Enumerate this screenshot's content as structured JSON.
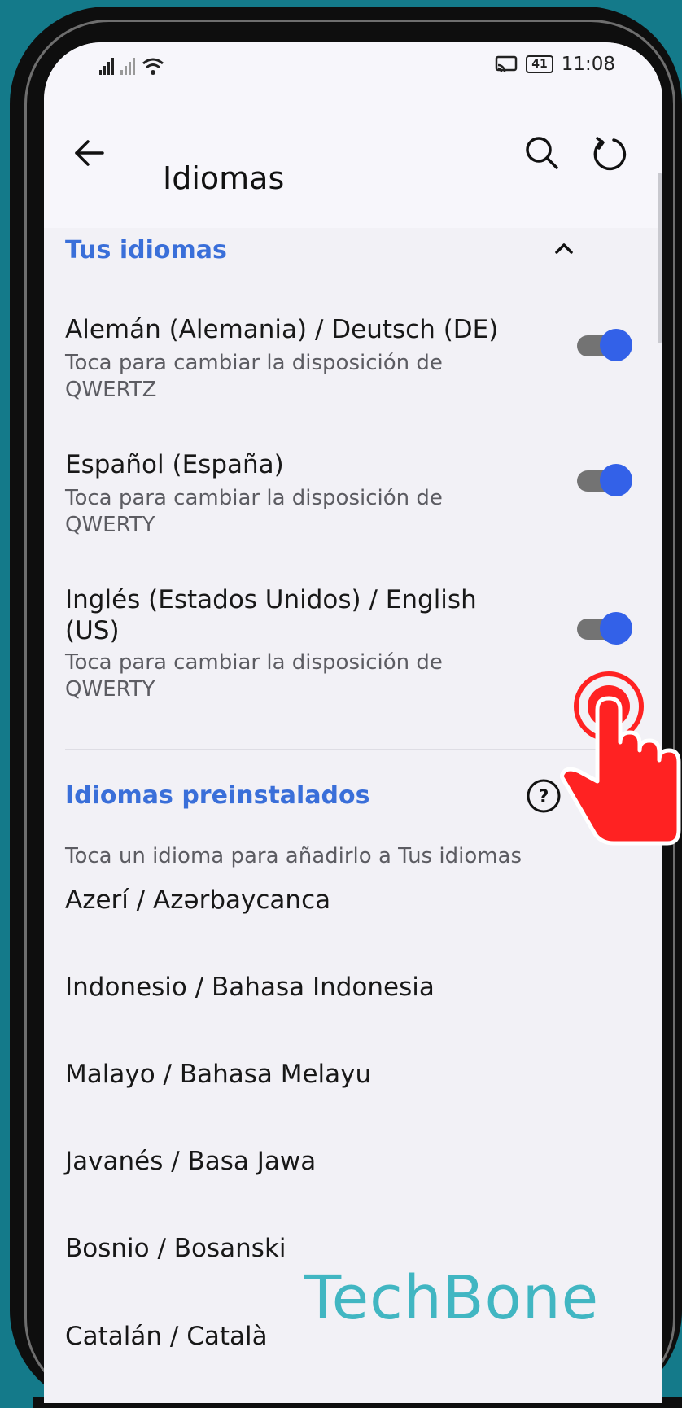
{
  "status_bar": {
    "time": "11:08",
    "battery": "41",
    "signal_icons": "signal-wifi-icons"
  },
  "app_bar": {
    "title": "Idiomas"
  },
  "your_languages": {
    "header": "Tus idiomas",
    "items": [
      {
        "title": "Alemán (Alemania) / Deutsch (DE)",
        "subtitle_line1": "Toca para cambiar la disposición de",
        "subtitle_line2": "QWERTZ",
        "enabled": true
      },
      {
        "title": "Español (España)",
        "subtitle_line1": "Toca para cambiar la disposición de",
        "subtitle_line2": "QWERTY",
        "enabled": true
      },
      {
        "title_line1": "Inglés (Estados Unidos) / English",
        "title_line2": "(US)",
        "subtitle_line1": "Toca para cambiar la disposición de",
        "subtitle_line2": "QWERTY",
        "enabled": true
      }
    ]
  },
  "preinstalled": {
    "header": "Idiomas preinstalados",
    "hint": "Toca un idioma para añadirlo a Tus idiomas",
    "items": [
      "Azerí / Azərbaycanca",
      "Indonesio / Bahasa Indonesia",
      "Malayo / Bahasa Melayu",
      "Javanés / Basa Jawa",
      "Bosnio / Bosanski",
      "Catalán / Català"
    ]
  },
  "watermark": "TechBone",
  "colors": {
    "accent": "#3a6fd9",
    "toggle_on": "#3361e8",
    "tap_indicator": "#ff2222",
    "watermark": "#41b6c2"
  }
}
